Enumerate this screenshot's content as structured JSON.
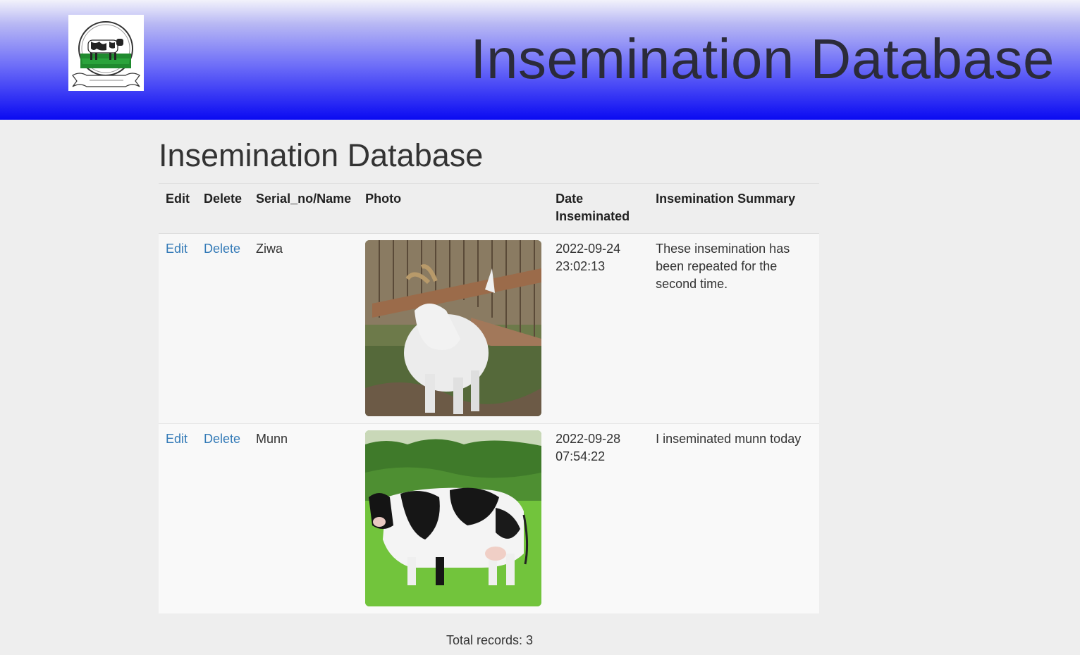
{
  "header": {
    "title": "Insemination Database",
    "logo_icon": "cow-logo-icon"
  },
  "page": {
    "title": "Insemination Database"
  },
  "table": {
    "columns": {
      "edit": "Edit",
      "delete": "Delete",
      "name": "Serial_no/Name",
      "photo": "Photo",
      "date_line1": "Date",
      "date_line2": "Inseminated",
      "summary": "Insemination Summary"
    },
    "rows": [
      {
        "edit": "Edit",
        "delete": "Delete",
        "name": "Ziwa",
        "photo_icon": "goat-photo",
        "date": "2022-09-24",
        "time": "23:02:13",
        "summary": "These insemination has been repeated for the second time."
      },
      {
        "edit": "Edit",
        "delete": "Delete",
        "name": "Munn",
        "photo_icon": "cow-photo",
        "date": "2022-09-28",
        "time": "07:54:22",
        "summary": "I inseminated munn today"
      }
    ]
  },
  "footer": {
    "total_records": "Total records: 3"
  },
  "colors": {
    "header_top": "#f2f2fb",
    "header_bottom": "#0a0af2",
    "link": "#337ab7",
    "background": "#eeeeee"
  }
}
